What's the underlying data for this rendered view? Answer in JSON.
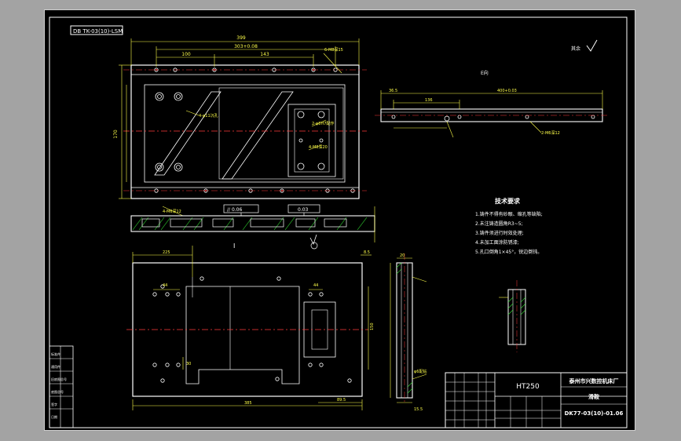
{
  "drawing": {
    "code_tab": "DB TK-03(10)-LSM",
    "roughness_note": "其余",
    "view_label_a": "E向",
    "section_label": "I",
    "tolerance_parallel": "// 0.06",
    "tolerance_flat": "0.03",
    "tech": {
      "title": "技术要求",
      "items": [
        "1.铸件不得有砂眼、缩孔等缺陷;",
        "2.未注铸造圆角R3~5;",
        "3.铸件须进行时效处理;",
        "4.未加工面涂防锈漆;",
        "5.孔口倒角1×45°，锐边倒钝。"
      ]
    },
    "dims": {
      "top_overall": "399",
      "top_span": "303+0.08",
      "top_left": "100",
      "top_mid": "143",
      "left_height": "170",
      "view_a_length": "400+0.03",
      "view_a_part": "136",
      "view_a_short": "36.5",
      "bottom_width": "385",
      "bottom_right": "89.5",
      "bottom_left_top": "225",
      "bottom_side": "8.5",
      "bottom_small": "44",
      "bottom_small2": "44",
      "bottom_h": "150",
      "bottom_h2": "30",
      "side_w": "15.5",
      "side_h": "20"
    },
    "callouts": {
      "thread_1": "6-M8深15",
      "thread_2": "4-M6深12",
      "thread_3": "2-φ8H7配作",
      "thread_4": "4-M8深20",
      "thread_5": "2-M6深12",
      "hole_1": "4-φ11沉孔",
      "hole_2": "φ6配钻"
    }
  },
  "title_block": {
    "material": "HT250",
    "company": "泰州市兴数控机床厂",
    "part_name": "滑鞍",
    "drawing_no": "DK77-03(10)-01.06",
    "left_strip": [
      "标准件",
      "通用件",
      "旧底图总号",
      "底图总号",
      "签字",
      "日期"
    ]
  },
  "colors": {
    "canvas": "#000000",
    "outline": "#ffffff",
    "dimension": "#ffff4a",
    "hatch": "#34e134",
    "centerline": "#ff3a3a",
    "hidden": "#49d5ff",
    "frame_bg": "#a3a3a3"
  }
}
